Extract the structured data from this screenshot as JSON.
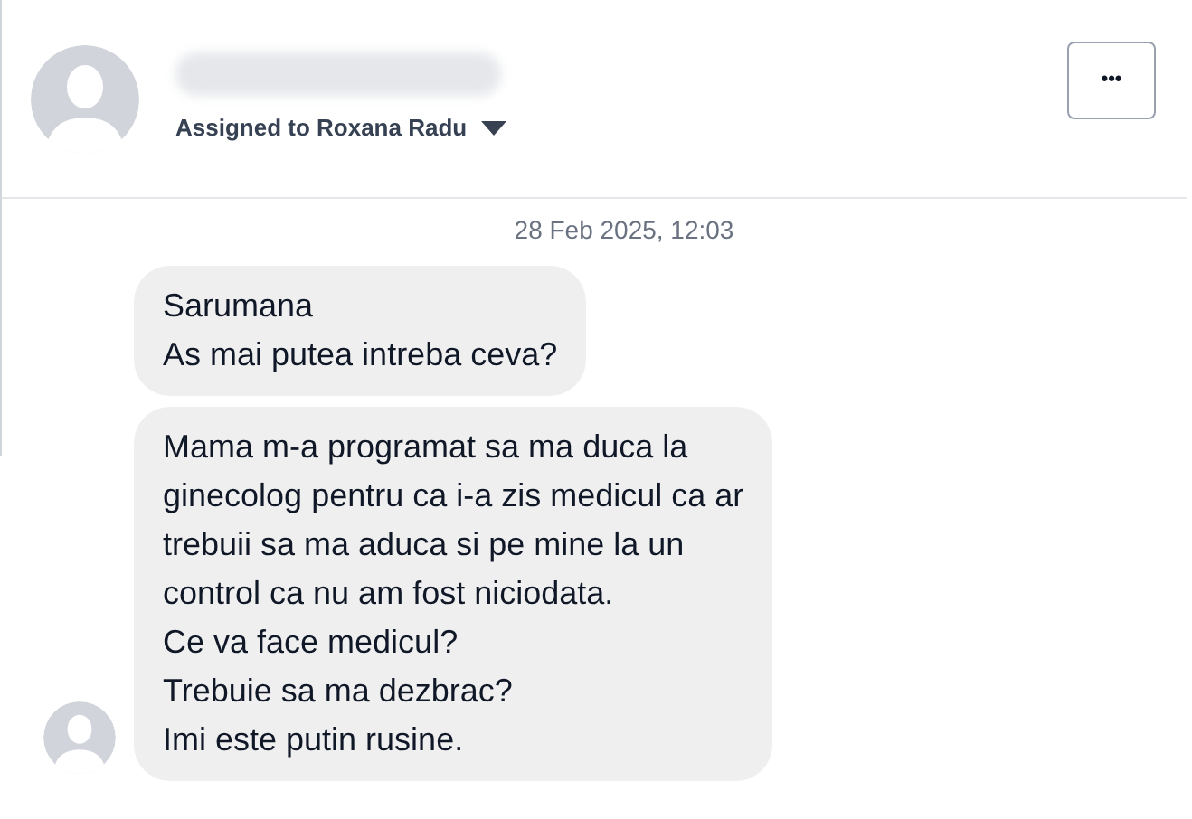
{
  "header": {
    "assignee": "Assigned to Roxana Radu",
    "menu_button": "•••"
  },
  "timestamp": "28 Feb 2025, 12:03",
  "messages": [
    {
      "text": "Sarumana\nAs mai putea intreba ceva?",
      "show_avatar": false
    },
    {
      "text": "Mama m-a programat sa ma duca la\nginecolog pentru ca i-a zis medicul ca ar\ntrebuii sa ma aduca si pe mine la un\ncontrol ca nu am fost niciodata.\nCe va face medicul?\nTrebuie sa ma dezbrac?\nImi este putin rusine.",
      "show_avatar": true
    }
  ]
}
